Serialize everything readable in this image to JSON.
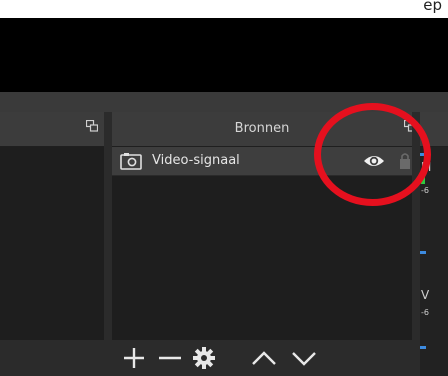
{
  "caption": {
    "text": "ep"
  },
  "scenes_dock": {
    "title": "",
    "float_icon": "float-window-icon"
  },
  "sources_dock": {
    "title": "Bronnen",
    "float_icon": "float-window-icon",
    "sources": [
      {
        "name": "Video-signaal",
        "icon": "camera-icon",
        "visible": true
      }
    ],
    "footer_buttons": [
      {
        "name": "add",
        "icon": "plus-icon",
        "glyph": "+"
      },
      {
        "name": "remove",
        "icon": "minus-icon",
        "glyph": "—"
      },
      {
        "name": "properties",
        "icon": "gear-icon",
        "glyph": "⚙"
      },
      {
        "name": "move-up",
        "icon": "chevron-up-icon",
        "glyph": "∧"
      },
      {
        "name": "move-down",
        "icon": "chevron-down-icon",
        "glyph": "∨"
      }
    ]
  },
  "mixer_dock": {
    "labels": [
      "M",
      "-6",
      "V",
      "-6"
    ]
  },
  "colors": {
    "annotation": "#e5101e",
    "accent": "#3d8be0",
    "meter_green": "#2ecc40"
  }
}
